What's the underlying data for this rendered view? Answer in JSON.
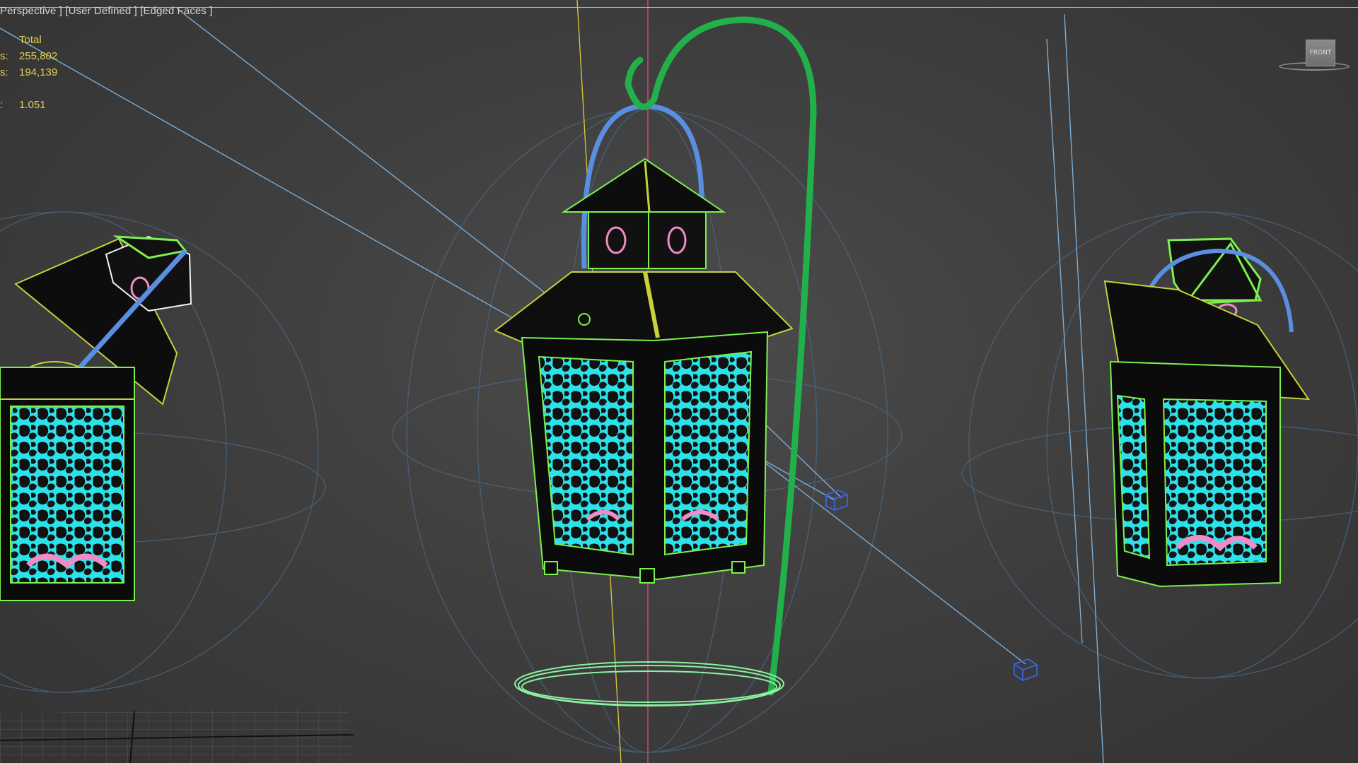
{
  "viewport": {
    "label_parts": [
      "Perspective ]",
      "[User Defined ]",
      "[Edged Faces ]"
    ],
    "stats": {
      "header": "Total",
      "polys_key": "s:",
      "polys_value": "255,802",
      "verts_key": "s:",
      "verts_value": "194,139",
      "fps_key": ":",
      "fps_value": "1.051"
    },
    "viewcube_face": "FRONT"
  },
  "colors": {
    "background": "#3f3f3f",
    "viewport_border": "#c8b85a",
    "stats_text": "#e2cf57",
    "lantern_glass": "#2ce2ea",
    "lantern_outline": "#7cf04e",
    "hook_green": "#22b04a",
    "handle_blue": "#5a8ee0",
    "light_wire": "#6fa8d8",
    "helper_blue": "#3c5fd0",
    "pink_detail": "#f08cc8"
  },
  "scene_objects": [
    "lantern-left",
    "lantern-center",
    "lantern-right",
    "shepherd-hook",
    "hook-base-ring",
    "spotlight-helpers",
    "ground-grid"
  ]
}
